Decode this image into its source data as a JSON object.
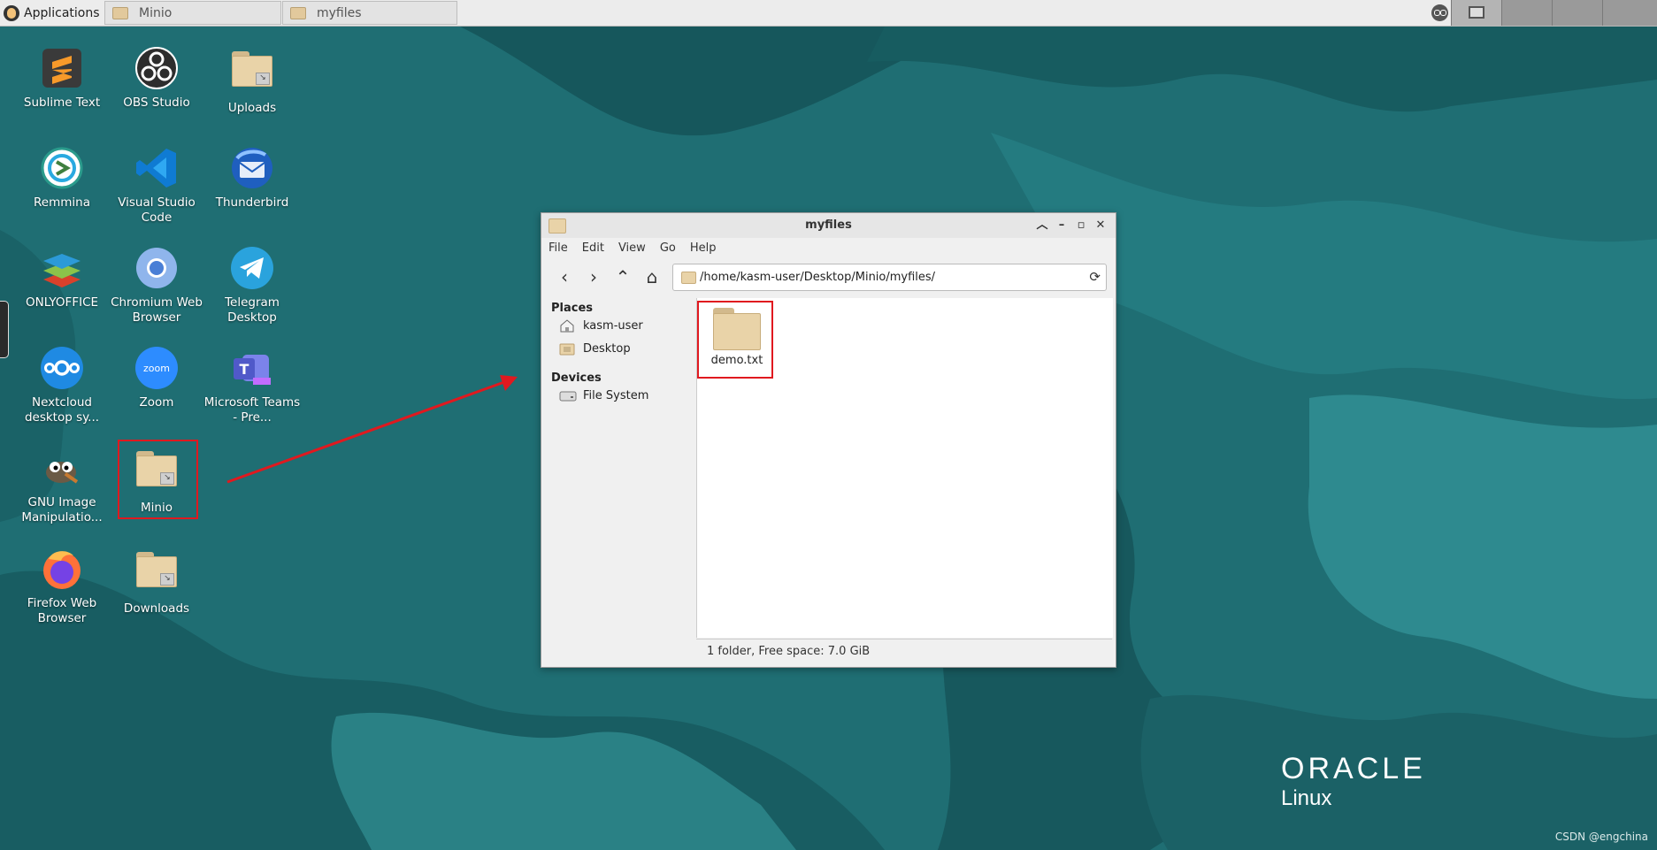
{
  "taskbar": {
    "applications_label": "Applications",
    "tasks": [
      {
        "label": "Minio"
      },
      {
        "label": "myfiles"
      }
    ]
  },
  "desktop_icons": [
    {
      "label": "Sublime Text",
      "icon": "sublime-text-icon"
    },
    {
      "label": "OBS Studio",
      "icon": "obs-studio-icon"
    },
    {
      "label": "Uploads",
      "icon": "folder-link-icon"
    },
    {
      "label": "Remmina",
      "icon": "remmina-icon"
    },
    {
      "label": "Visual Studio Code",
      "icon": "vscode-icon"
    },
    {
      "label": "Thunderbird",
      "icon": "thunderbird-icon"
    },
    {
      "label": "ONLYOFFICE",
      "icon": "onlyoffice-icon"
    },
    {
      "label": "Chromium Web Browser",
      "icon": "chromium-icon"
    },
    {
      "label": "Telegram Desktop",
      "icon": "telegram-icon"
    },
    {
      "label": "Nextcloud desktop sy...",
      "icon": "nextcloud-icon"
    },
    {
      "label": "Zoom",
      "icon": "zoom-icon"
    },
    {
      "label": "Microsoft Teams - Pre...",
      "icon": "teams-icon"
    },
    {
      "label": "GNU Image Manipulatio...",
      "icon": "gimp-icon"
    },
    {
      "label": "Minio",
      "icon": "folder-link-icon"
    },
    {
      "label": "Firefox Web Browser",
      "icon": "firefox-icon"
    },
    {
      "label": "Downloads",
      "icon": "folder-link-icon"
    }
  ],
  "window": {
    "title": "myfiles",
    "menu": [
      "File",
      "Edit",
      "View",
      "Go",
      "Help"
    ],
    "path": "/home/kasm-user/Desktop/Minio/myfiles/",
    "places_heading": "Places",
    "places": [
      {
        "label": "kasm-user",
        "icon": "home-icon"
      },
      {
        "label": "Desktop",
        "icon": "desktop-icon"
      }
    ],
    "devices_heading": "Devices",
    "devices": [
      {
        "label": "File System",
        "icon": "drive-icon"
      }
    ],
    "items": [
      {
        "label": "demo.txt",
        "icon": "folder-icon"
      }
    ],
    "status": "1 folder, Free space: 7.0 GiB"
  },
  "wallpaper": {
    "brand": "ORACLE",
    "brand_sub": "Linux"
  },
  "watermark": "CSDN @engchina",
  "colors": {
    "wallpaper_base": "#1e6f74",
    "highlight": "#e0191f",
    "folder": "#e9d3a8"
  }
}
